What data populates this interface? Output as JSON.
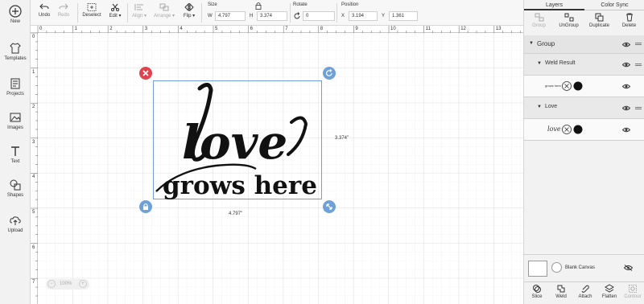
{
  "rail": {
    "new": "New",
    "templates": "Templates",
    "projects": "Projects",
    "images": "Images",
    "text": "Text",
    "shapes": "Shapes",
    "upload": "Upload"
  },
  "toolbar": {
    "undo": "Undo",
    "redo": "Redo",
    "deselect": "Deselect",
    "edit": "Edit ▾",
    "align": "Align ▾",
    "arrange": "Arrange ▾",
    "flip": "Flip ▾",
    "size_label": "Size",
    "w_label": "W",
    "w_value": "4.797",
    "h_label": "H",
    "h_value": "3.374",
    "rotate_label": "Rotate",
    "rotate_value": "0",
    "position_label": "Position",
    "x_label": "X",
    "x_value": "3.194",
    "y_label": "Y",
    "y_value": "1.361"
  },
  "canvas": {
    "ruler_top": [
      "0",
      "1",
      "2",
      "3",
      "4",
      "5",
      "6",
      "7",
      "8",
      "9",
      "10",
      "11",
      "12",
      "13"
    ],
    "ruler_left": [
      "0",
      "1",
      "2",
      "3",
      "4",
      "5",
      "6",
      "7"
    ],
    "design_word1": "love",
    "design_word2": "grows here",
    "height_dim": "3.374\"",
    "width_dim": "4.797\"",
    "zoom_minus": "−",
    "zoom_level": "100%",
    "zoom_plus": "+"
  },
  "panel": {
    "tab_layers": "Layers",
    "tab_color_sync": "Color Sync",
    "tool_group": "Group",
    "tool_ungroup": "UnGroup",
    "tool_duplicate": "Duplicate",
    "tool_delete": "Delete",
    "layer_group": "Group",
    "layer_weld_result": "Weld Result",
    "layer_love": "Love",
    "thumb1_text": "grows here",
    "thumb2_text": "love",
    "blank_canvas": "Blank Canvas",
    "slice": "Slice",
    "weld": "Weld",
    "attach": "Attach",
    "flatten": "Flatten",
    "contour": "Contour"
  },
  "colors": {
    "accent_red": "#e0424f",
    "accent_blue": "#6fa0d6",
    "ink": "#111111"
  }
}
